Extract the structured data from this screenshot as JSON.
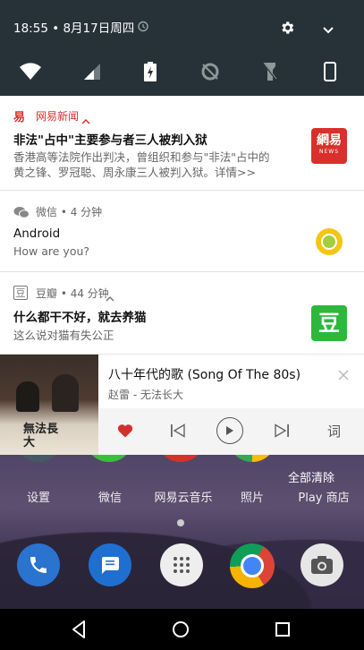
{
  "status_bar": {
    "time_date": "18:55 • 8月17日周四"
  },
  "quick_settings": [
    "wifi",
    "cellular",
    "battery-charging",
    "data-saver-off",
    "flashlight-off",
    "screen-rotation"
  ],
  "notifications": [
    {
      "app": "网易新闻",
      "title": "非法\"占中\"主要参与者三人被判入狱",
      "text_line1": "香港高等法院作出判决，曾组织和参与\"非法\"占中的",
      "text_line2": "黄之锋、罗冠聪、周永康三人被判入狱。详情>>",
      "badge": "網易",
      "badge_sub": "NEWS"
    },
    {
      "app": "微信 • 4 分钟",
      "title": "Android",
      "text": "How are you?"
    },
    {
      "app": "豆瓣 • 44 分钟",
      "title": "什么都干不好，就去养猫",
      "text": "这么说对猫有失公正",
      "badge": "豆"
    }
  ],
  "media": {
    "song": "八十年代的歌 (Song Of The 80s)",
    "artist": "赵雷 - 无法长大",
    "lyrics_button": "词",
    "album_text": "無法長大"
  },
  "home": {
    "clear_all": "全部清除",
    "apps": [
      "设置",
      "微信",
      "网易云音乐",
      "照片",
      "Play 商店"
    ]
  },
  "colors": {
    "shade": "#263238",
    "netease_red": "#d9302c",
    "douban_green": "#2db83d",
    "heart_red": "#d32f2f"
  }
}
